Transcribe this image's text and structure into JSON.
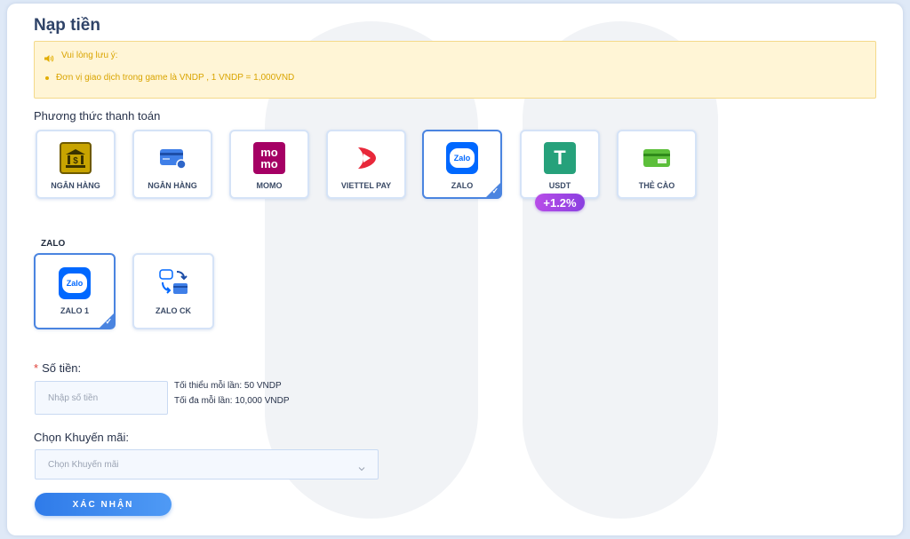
{
  "page": {
    "title": "Nạp tiền"
  },
  "notice": {
    "title": "Vui lòng lưu ý:",
    "items": [
      "Đơn vị giao dịch trong game là VNDP , 1 VNDP = 1,000VND"
    ],
    "text_color": "#d9a400",
    "bg_color": "#fff5d6"
  },
  "payment": {
    "label": "Phương thức thanh toán",
    "methods": [
      {
        "label": "NGÂN HÀNG",
        "icon": "bank-icon",
        "selected": false
      },
      {
        "label": "NGÂN HÀNG",
        "icon": "credit-card-icon",
        "selected": false
      },
      {
        "label": "MOMO",
        "icon": "momo-logo-icon",
        "selected": false
      },
      {
        "label": "VIETTEL PAY",
        "icon": "viettel-pay-logo-icon",
        "selected": false
      },
      {
        "label": "ZALO",
        "icon": "zalo-logo-icon",
        "selected": true
      },
      {
        "label": "USDT",
        "icon": "tether-logo-icon",
        "selected": false
      },
      {
        "label": "THẺ CÀO",
        "icon": "scratch-card-icon",
        "selected": false
      }
    ],
    "bonus_badge": "+1.2%",
    "momo_logo_text": "mo",
    "zalo_logo_text": "Zalo",
    "tether_logo_text": "T"
  },
  "zalo_options": {
    "title": "ZALO",
    "items": [
      {
        "label": "ZALO 1",
        "icon": "zalo-logo-icon",
        "selected": true
      },
      {
        "label": "ZALO CK",
        "icon": "zalo-transfer-icon",
        "selected": false
      }
    ]
  },
  "amount": {
    "label": "Số tiền:",
    "required_mark": "*",
    "placeholder": "Nhập số tiền",
    "min_text": "Tối thiểu mỗi lần: 50 VNDP",
    "max_text": "Tối đa mỗi lần: 10,000 VNDP"
  },
  "promotion": {
    "label": "Chọn Khuyến mãi:",
    "placeholder": "Chọn Khuyến mãi"
  },
  "confirm_button": {
    "label": "XÁC NHẬN"
  },
  "colors": {
    "accent": "#4a84e0",
    "title": "#2f4368",
    "bonus_start": "#b84de8",
    "bonus_end": "#8a3fe0"
  }
}
